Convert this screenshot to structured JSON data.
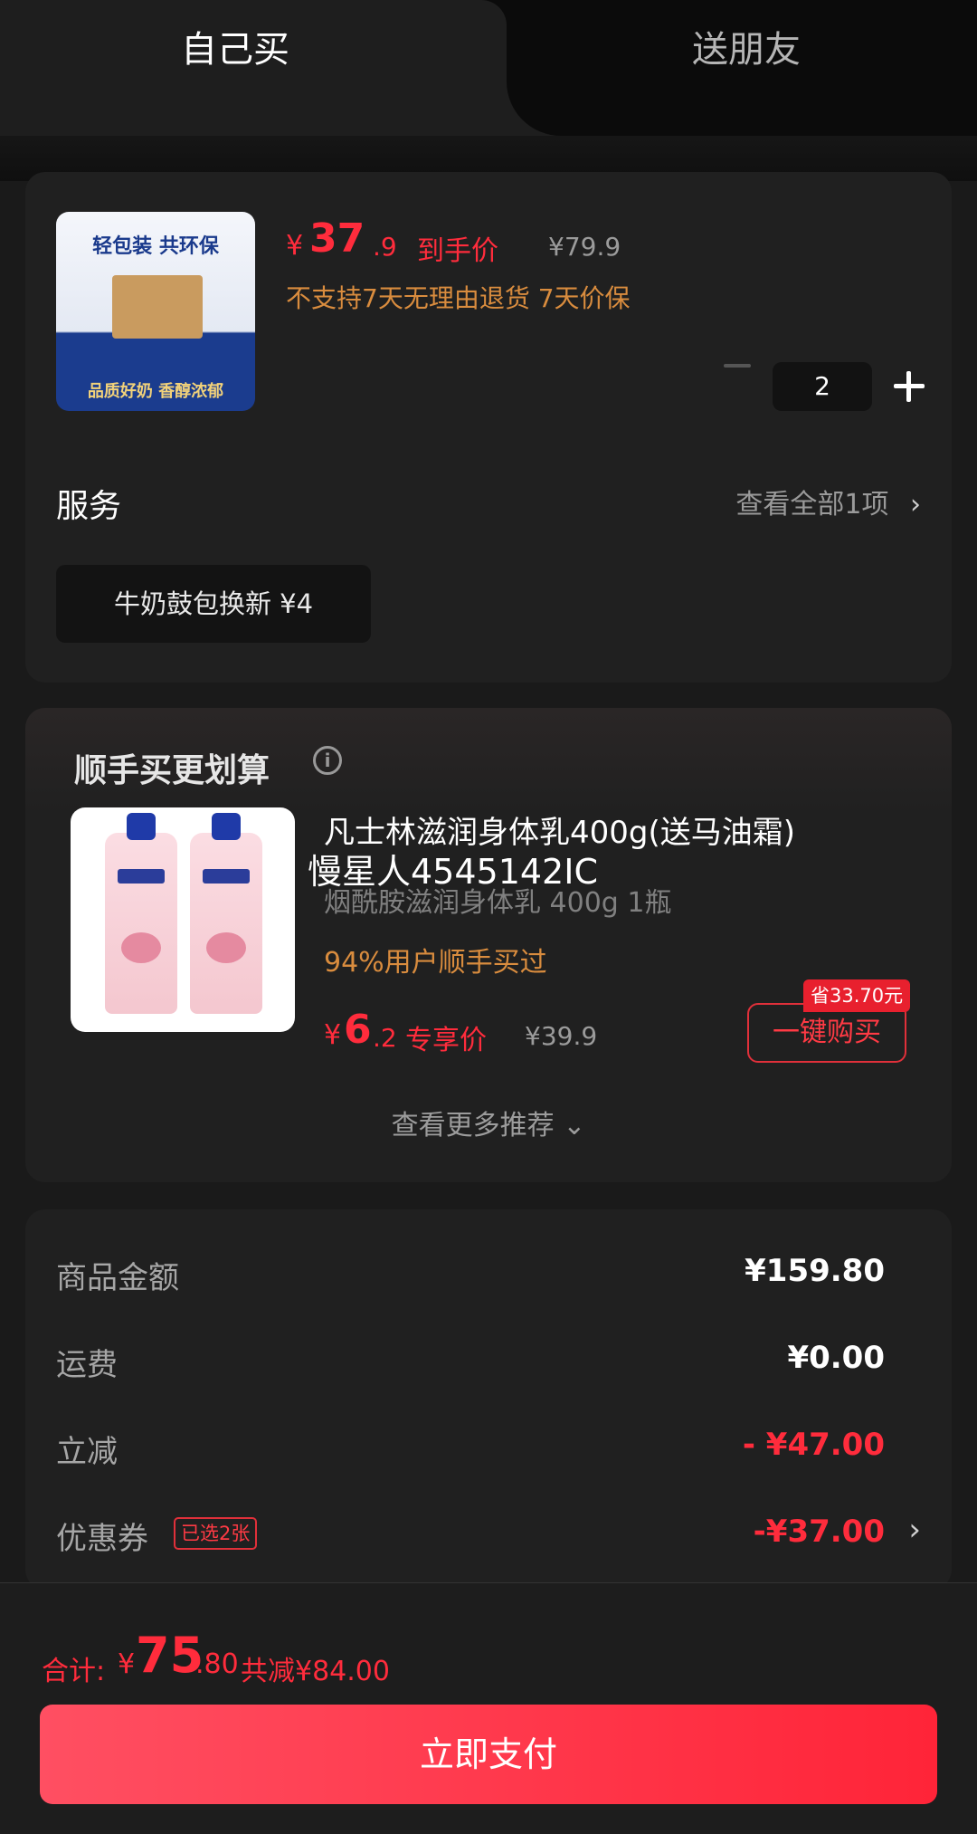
{
  "tabs": {
    "self": "自己买",
    "friend": "送朋友"
  },
  "product": {
    "image_slogan": "轻包装 共环保",
    "image_bottom": "品质好奶 香醇浓郁",
    "price_currency": "¥",
    "price_integer": "37",
    "price_decimal": ".9",
    "price_tag": "到手价",
    "original_price": "¥79.9",
    "policy": "不支持7天无理由退货  7天价保",
    "quantity": "2"
  },
  "service": {
    "title": "服务",
    "view_all": "查看全部1项",
    "chip": "牛奶鼓包换新  ¥4"
  },
  "upsell": {
    "title": "顺手买更划算",
    "info_icon": "i",
    "name": "凡士林滋润身体乳400g(送马油霜)",
    "overlay": "慢星人4545142IC",
    "sub": "烟酰胺滋润身体乳 400g 1瓶",
    "stat": "94%用户顺手买过",
    "price_currency": "¥",
    "price_integer": "6",
    "price_decimal": ".2",
    "price_tag": "专享价",
    "original_price": "¥39.9",
    "save_badge": "省33.70元",
    "buy_label": "一键购买",
    "more": "查看更多推荐 ⌄"
  },
  "summary": {
    "goods_label": "商品金额",
    "goods_value": "¥159.80",
    "shipping_label": "运费",
    "shipping_value": "¥0.00",
    "discount_label": "立减",
    "discount_value": "- ¥47.00",
    "coupon_label": "优惠券",
    "coupon_badge": "已选2张",
    "coupon_value": "-¥37.00"
  },
  "footer": {
    "total_label": "合计:",
    "total_currency": "¥",
    "total_integer": "75",
    "total_decimal": ".80",
    "total_saved": "共减¥84.00",
    "pay_label": "立即支付"
  },
  "icons": {
    "chevron": "›"
  },
  "colors": {
    "accent_red": "#ff2c3c",
    "orange": "#d98c3e",
    "background": "#1a1a1a"
  }
}
